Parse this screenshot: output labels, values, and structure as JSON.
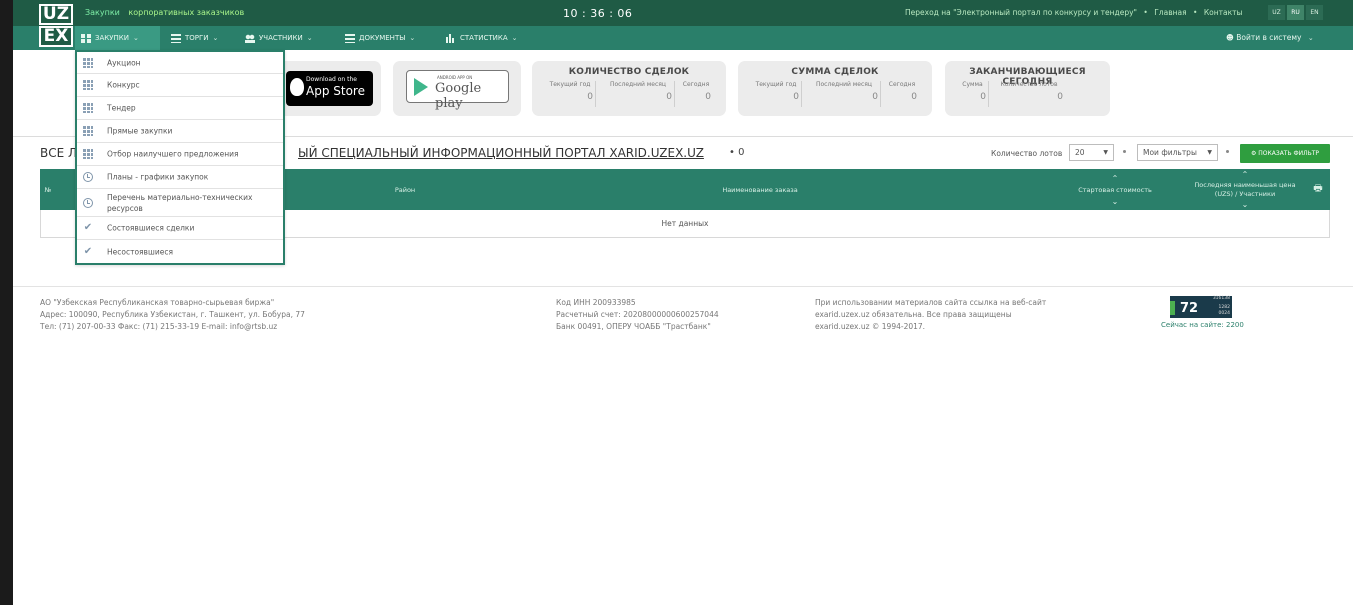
{
  "header": {
    "logo_top": "UZ",
    "logo_bottom": "EX",
    "title_part1": "Закупки",
    "title_part2": "корпоративных заказчиков",
    "clock": "10 : 36 : 06",
    "portal_link": "Переход на \"Электронный портал по конкурсу и тендеру\"",
    "home_link": "Главная",
    "contacts_link": "Контакты",
    "languages": [
      "UZ",
      "RU",
      "EN"
    ],
    "active_language": "RU"
  },
  "nav": {
    "items": [
      {
        "label": "ЗАКУПКИ",
        "icon": "grid-icon"
      },
      {
        "label": "ТОРГИ",
        "icon": "list-icon"
      },
      {
        "label": "УЧАСТНИКИ",
        "icon": "users-icon"
      },
      {
        "label": "ДОКУМЕНТЫ",
        "icon": "list-icon"
      },
      {
        "label": "СТАТИСТИКА",
        "icon": "bar-chart-icon"
      }
    ],
    "login": "Войти в систему"
  },
  "dropdown": {
    "items": [
      {
        "label": "Аукцион",
        "icon": "grid-icon"
      },
      {
        "label": "Конкурс",
        "icon": "grid-icon"
      },
      {
        "label": "Тендер",
        "icon": "grid-icon"
      },
      {
        "label": "Прямые закупки",
        "icon": "grid-icon"
      },
      {
        "label": "Отбор наилучшего предложения",
        "icon": "grid-icon"
      },
      {
        "label": "Планы - графики закупок",
        "icon": "clock-icon"
      },
      {
        "label": "Перечень материально-технических ресурсов",
        "icon": "clock-icon"
      },
      {
        "label": "Состоявшиеся сделки",
        "icon": "check-icon"
      },
      {
        "label": "Несостоявшиеся",
        "icon": "check-icon"
      }
    ]
  },
  "stores": {
    "appstore_small": "Download on the",
    "appstore_big": "App Store",
    "gplay_small": "ANDROID APP ON",
    "gplay_big": "Google play"
  },
  "stats": {
    "deals": {
      "title": "КОЛИЧЕСТВО СДЕЛОК",
      "cols": [
        {
          "label": "Текущий год",
          "value": "0"
        },
        {
          "label": "Последний месяц",
          "value": "0"
        },
        {
          "label": "Сегодня",
          "value": "0"
        }
      ]
    },
    "sum": {
      "title": "СУММА СДЕЛОК",
      "cols": [
        {
          "label": "Текущий год",
          "value": "0"
        },
        {
          "label": "Последний месяц",
          "value": "0"
        },
        {
          "label": "Сегодня",
          "value": "0"
        }
      ]
    },
    "ending": {
      "title": "ЗАКАНЧИВАЮЩИЕСЯ СЕГОДНЯ",
      "cols": [
        {
          "label": "Сумма",
          "value": "0"
        },
        {
          "label": "Количество лотов",
          "value": "0"
        }
      ]
    }
  },
  "main": {
    "heading_start": "ВСЕ Л",
    "heading_portal": "ЫЙ СПЕЦИАЛЬНЫЙ ИНФОРМАЦИОННЫЙ ПОРТАЛ XARID.UZEX.UZ",
    "heading_count": "• 0",
    "lots_label": "Количество лотов",
    "lots_value": "20",
    "my_filters": "Мои фильтры",
    "show_filter": "ПОКАЗАТЬ ФИЛЬТР"
  },
  "table": {
    "headers": {
      "num": "№",
      "district": "Район",
      "name": "Наименование заказа",
      "start_price": "Стартовая стоимость",
      "last_price": "Последняя наименьшая цена (UZS) / Участники"
    },
    "empty": "Нет данных"
  },
  "footer": {
    "col1": [
      "АО \"Узбекская Республиканская товарно-сырьевая биржа\"",
      "Адрес: 100090, Республика Узбекистан, г. Ташкент, ул. Бобура, 77",
      "Тел: (71) 207-00-33 Факс: (71) 215-33-19 E-mail: info@rtsb.uz"
    ],
    "col2": [
      "Код ИНН 200933985",
      "Расчетный счет: 20208000000600257044",
      "Банк 00491, ОПЕРУ ЧОАББ \"Трастбанк\""
    ],
    "col3": [
      "При использовании материалов сайта ссылка на веб-сайт",
      "exarid.uzex.uz обязательна. Все права защищены",
      "exarid.uzex.uz © 1994-2017."
    ],
    "counter_top": "316138",
    "counter_big": "72",
    "counter_r1": "1282",
    "counter_r2": "0024",
    "online_caption": "Сейчас на сайте: 2200"
  }
}
